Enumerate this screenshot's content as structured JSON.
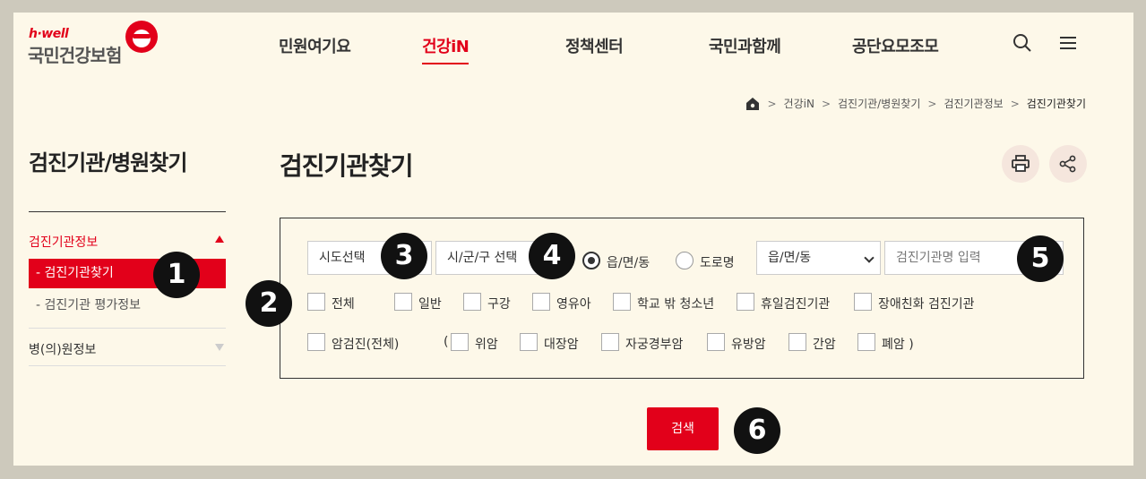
{
  "header": {
    "logo_small": "h·well",
    "logo_big": "국민건강보험",
    "nav": [
      "민원여기요",
      "건강iN",
      "정책센터",
      "국민과함께",
      "공단요모조모"
    ],
    "active_nav": "건강iN",
    "icons": [
      "search-icon",
      "menu-icon"
    ]
  },
  "breadcrumb": {
    "items": [
      "건강iN",
      "검진기관/병원찾기",
      "검진기관정보",
      "검진기관찾기"
    ]
  },
  "lnb": {
    "title": "검진기관/병원찾기",
    "group1": "검진기관정보",
    "selected": "- 검진기관찾기",
    "sub": "- 검진기관 평가정보",
    "group2": "병(의)원정보"
  },
  "page": {
    "title": "검진기관찾기",
    "icons": [
      "print-icon",
      "share-icon"
    ]
  },
  "search": {
    "sido": "시도선택",
    "sigungu": "시/군/구 선택",
    "radio_options": [
      "읍/면/동",
      "도로명"
    ],
    "radio_selected": "읍/면/동",
    "eupmyeondong": "읍/면/동",
    "name_placeholder": "검진기관명 입력",
    "checkboxes_row1": [
      "전체",
      "일반",
      "구강",
      "영유아",
      "학교 밖 청소년",
      "휴일검진기관",
      "장애친화 검진기관"
    ],
    "checkbox_cancer_all": "암검진(전체)",
    "paren_open": "(",
    "checkboxes_row2": [
      "위암",
      "대장암",
      "자궁경부암",
      "유방암",
      "간암",
      "폐암 )"
    ],
    "button": "검색"
  },
  "markers": [
    "1",
    "2",
    "3",
    "4",
    "5",
    "6"
  ],
  "colors": {
    "brand_red": "#e2001a",
    "background": "#fdf8e9",
    "frame": "#cdc9bc"
  }
}
